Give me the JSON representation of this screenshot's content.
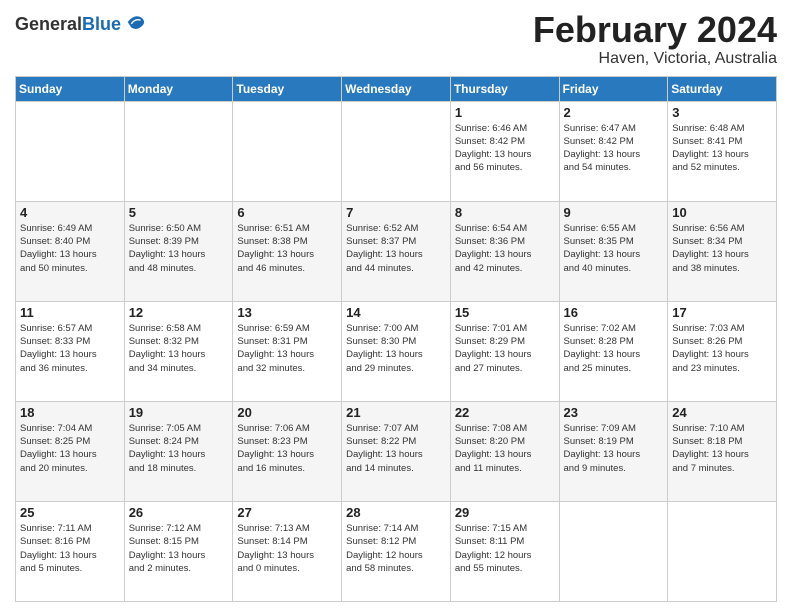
{
  "logo": {
    "general": "General",
    "blue": "Blue"
  },
  "header": {
    "month": "February 2024",
    "location": "Haven, Victoria, Australia"
  },
  "days_of_week": [
    "Sunday",
    "Monday",
    "Tuesday",
    "Wednesday",
    "Thursday",
    "Friday",
    "Saturday"
  ],
  "weeks": [
    [
      {
        "day": "",
        "info": ""
      },
      {
        "day": "",
        "info": ""
      },
      {
        "day": "",
        "info": ""
      },
      {
        "day": "",
        "info": ""
      },
      {
        "day": "1",
        "info": "Sunrise: 6:46 AM\nSunset: 8:42 PM\nDaylight: 13 hours\nand 56 minutes."
      },
      {
        "day": "2",
        "info": "Sunrise: 6:47 AM\nSunset: 8:42 PM\nDaylight: 13 hours\nand 54 minutes."
      },
      {
        "day": "3",
        "info": "Sunrise: 6:48 AM\nSunset: 8:41 PM\nDaylight: 13 hours\nand 52 minutes."
      }
    ],
    [
      {
        "day": "4",
        "info": "Sunrise: 6:49 AM\nSunset: 8:40 PM\nDaylight: 13 hours\nand 50 minutes."
      },
      {
        "day": "5",
        "info": "Sunrise: 6:50 AM\nSunset: 8:39 PM\nDaylight: 13 hours\nand 48 minutes."
      },
      {
        "day": "6",
        "info": "Sunrise: 6:51 AM\nSunset: 8:38 PM\nDaylight: 13 hours\nand 46 minutes."
      },
      {
        "day": "7",
        "info": "Sunrise: 6:52 AM\nSunset: 8:37 PM\nDaylight: 13 hours\nand 44 minutes."
      },
      {
        "day": "8",
        "info": "Sunrise: 6:54 AM\nSunset: 8:36 PM\nDaylight: 13 hours\nand 42 minutes."
      },
      {
        "day": "9",
        "info": "Sunrise: 6:55 AM\nSunset: 8:35 PM\nDaylight: 13 hours\nand 40 minutes."
      },
      {
        "day": "10",
        "info": "Sunrise: 6:56 AM\nSunset: 8:34 PM\nDaylight: 13 hours\nand 38 minutes."
      }
    ],
    [
      {
        "day": "11",
        "info": "Sunrise: 6:57 AM\nSunset: 8:33 PM\nDaylight: 13 hours\nand 36 minutes."
      },
      {
        "day": "12",
        "info": "Sunrise: 6:58 AM\nSunset: 8:32 PM\nDaylight: 13 hours\nand 34 minutes."
      },
      {
        "day": "13",
        "info": "Sunrise: 6:59 AM\nSunset: 8:31 PM\nDaylight: 13 hours\nand 32 minutes."
      },
      {
        "day": "14",
        "info": "Sunrise: 7:00 AM\nSunset: 8:30 PM\nDaylight: 13 hours\nand 29 minutes."
      },
      {
        "day": "15",
        "info": "Sunrise: 7:01 AM\nSunset: 8:29 PM\nDaylight: 13 hours\nand 27 minutes."
      },
      {
        "day": "16",
        "info": "Sunrise: 7:02 AM\nSunset: 8:28 PM\nDaylight: 13 hours\nand 25 minutes."
      },
      {
        "day": "17",
        "info": "Sunrise: 7:03 AM\nSunset: 8:26 PM\nDaylight: 13 hours\nand 23 minutes."
      }
    ],
    [
      {
        "day": "18",
        "info": "Sunrise: 7:04 AM\nSunset: 8:25 PM\nDaylight: 13 hours\nand 20 minutes."
      },
      {
        "day": "19",
        "info": "Sunrise: 7:05 AM\nSunset: 8:24 PM\nDaylight: 13 hours\nand 18 minutes."
      },
      {
        "day": "20",
        "info": "Sunrise: 7:06 AM\nSunset: 8:23 PM\nDaylight: 13 hours\nand 16 minutes."
      },
      {
        "day": "21",
        "info": "Sunrise: 7:07 AM\nSunset: 8:22 PM\nDaylight: 13 hours\nand 14 minutes."
      },
      {
        "day": "22",
        "info": "Sunrise: 7:08 AM\nSunset: 8:20 PM\nDaylight: 13 hours\nand 11 minutes."
      },
      {
        "day": "23",
        "info": "Sunrise: 7:09 AM\nSunset: 8:19 PM\nDaylight: 13 hours\nand 9 minutes."
      },
      {
        "day": "24",
        "info": "Sunrise: 7:10 AM\nSunset: 8:18 PM\nDaylight: 13 hours\nand 7 minutes."
      }
    ],
    [
      {
        "day": "25",
        "info": "Sunrise: 7:11 AM\nSunset: 8:16 PM\nDaylight: 13 hours\nand 5 minutes."
      },
      {
        "day": "26",
        "info": "Sunrise: 7:12 AM\nSunset: 8:15 PM\nDaylight: 13 hours\nand 2 minutes."
      },
      {
        "day": "27",
        "info": "Sunrise: 7:13 AM\nSunset: 8:14 PM\nDaylight: 13 hours\nand 0 minutes."
      },
      {
        "day": "28",
        "info": "Sunrise: 7:14 AM\nSunset: 8:12 PM\nDaylight: 12 hours\nand 58 minutes."
      },
      {
        "day": "29",
        "info": "Sunrise: 7:15 AM\nSunset: 8:11 PM\nDaylight: 12 hours\nand 55 minutes."
      },
      {
        "day": "",
        "info": ""
      },
      {
        "day": "",
        "info": ""
      }
    ]
  ]
}
